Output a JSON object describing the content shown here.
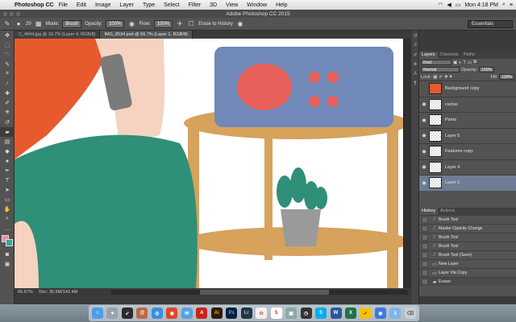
{
  "menubar": {
    "apple": "",
    "app": "Photoshop CC",
    "items": [
      "File",
      "Edit",
      "Image",
      "Layer",
      "Type",
      "Select",
      "Filter",
      "3D",
      "View",
      "Window",
      "Help"
    ],
    "clock": "Mon 4:18 PM"
  },
  "window_title": "Adobe Photoshop CC 2015",
  "options": {
    "mode_label": "Mode:",
    "mode_value": "Brush",
    "opacity_label": "Opacity:",
    "opacity_value": "100%",
    "flow_label": "Flow:",
    "flow_value": "100%",
    "erase_history": "Erase to History",
    "brush_size": "20",
    "workspace": "Essentials"
  },
  "doc_tabs": [
    "C_4944.jpg @ 16.7% (Layer 4, RGB/8)",
    "IMG_8534.psd @ 66.7% (Layer 1, RGB/8)"
  ],
  "status": {
    "zoom": "66.67%",
    "doc": "Doc: 35.9M/142.4M"
  },
  "layers_panel": {
    "tabs": [
      "Layers",
      "Channels",
      "Paths"
    ],
    "filter": "Kind",
    "blend": "Normal",
    "opacity_label": "Opacity:",
    "opacity": "100%",
    "lock_label": "Lock:",
    "fill_label": "Fill:",
    "fill": "100%",
    "layers": [
      "Background copy",
      "cactus",
      "Pants",
      "Layer 5",
      "Features copy",
      "Layer 4",
      "Layer 1"
    ],
    "selected": "Layer 1"
  },
  "history_panel": {
    "tabs": [
      "History",
      "Actions"
    ],
    "items": [
      "Brush Tool",
      "Master Opacity Change",
      "Brush Tool",
      "Brush Tool",
      "Brush Tool (Save)",
      "New Layer",
      "Layer Via Copy",
      "Eraser"
    ]
  },
  "dock_icons": [
    "Finder",
    "Launchpad",
    "Rocket",
    "Address Book",
    "Safari",
    "Chrome",
    "Mail",
    "Acrobat",
    "Illustrator",
    "Photoshop",
    "Lightroom",
    "Photos",
    "Calendar",
    "Preview",
    "Clock",
    "Skype",
    "Word",
    "Excel",
    "Norton",
    "Chrome Beta",
    "Downloads",
    "Trash"
  ],
  "colors": {
    "accent_select": "#6c7d95",
    "orange": "#e8592d",
    "teal": "#2f8f78",
    "wood": "#d6a25c",
    "blue": "#7089b8",
    "coral": "#e8605a"
  }
}
